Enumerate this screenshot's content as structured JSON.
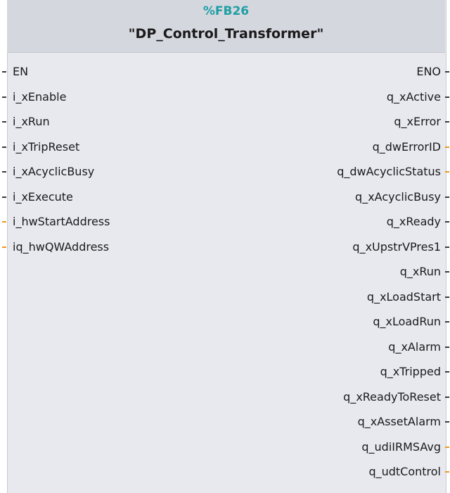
{
  "block": {
    "number": "%FB26",
    "name": "\"DP_Control_Transformer\""
  },
  "colors": {
    "header_bg": "#d4d7de",
    "body_bg": "#e7e9ef",
    "number_color": "#1f9ea3",
    "bool_pin": "#3a3a3a",
    "non_bool_pin": "#e89a1e"
  },
  "inputs": [
    {
      "label": "EN",
      "pin": "bool"
    },
    {
      "label": "i_xEnable",
      "pin": "bool"
    },
    {
      "label": "i_xRun",
      "pin": "bool"
    },
    {
      "label": "i_xTripReset",
      "pin": "bool"
    },
    {
      "label": "i_xAcyclicBusy",
      "pin": "bool"
    },
    {
      "label": "i_xExecute",
      "pin": "bool"
    },
    {
      "label": "i_hwStartAddress",
      "pin": "non-bool"
    },
    {
      "label": "iq_hwQWAddress",
      "pin": "non-bool"
    }
  ],
  "outputs": [
    {
      "label": "ENO",
      "pin": "bool"
    },
    {
      "label": "q_xActive",
      "pin": "bool"
    },
    {
      "label": "q_xError",
      "pin": "bool"
    },
    {
      "label": "q_dwErrorID",
      "pin": "non-bool"
    },
    {
      "label": "q_dwAcyclicStatus",
      "pin": "non-bool"
    },
    {
      "label": "q_xAcyclicBusy",
      "pin": "bool"
    },
    {
      "label": "q_xReady",
      "pin": "bool"
    },
    {
      "label": "q_xUpstrVPres1",
      "pin": "bool"
    },
    {
      "label": "q_xRun",
      "pin": "bool"
    },
    {
      "label": "q_xLoadStart",
      "pin": "bool"
    },
    {
      "label": "q_xLoadRun",
      "pin": "bool"
    },
    {
      "label": "q_xAlarm",
      "pin": "bool"
    },
    {
      "label": "q_xTripped",
      "pin": "bool"
    },
    {
      "label": "q_xReadyToReset",
      "pin": "bool"
    },
    {
      "label": "q_xAssetAlarm",
      "pin": "bool"
    },
    {
      "label": "q_udiIRMSAvg",
      "pin": "non-bool"
    },
    {
      "label": "q_udtControl",
      "pin": "non-bool"
    }
  ]
}
